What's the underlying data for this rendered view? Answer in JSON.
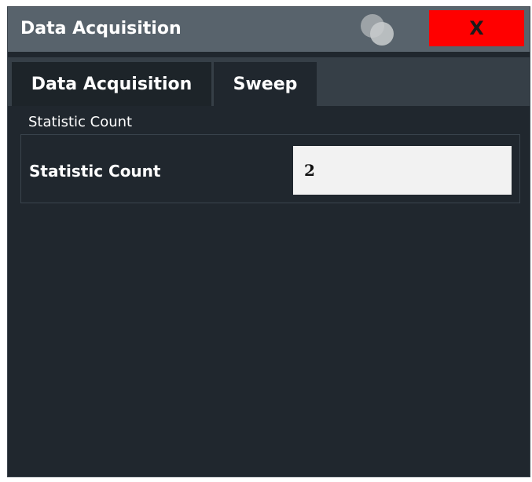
{
  "window": {
    "title": "Data Acquisition",
    "close_label": "X"
  },
  "tabs": [
    {
      "label": "Data Acquisition",
      "active": false
    },
    {
      "label": "Sweep",
      "active": true
    }
  ],
  "group": {
    "title": "Statistic Count",
    "field_label": "Statistic Count",
    "field_value": "2"
  },
  "colors": {
    "titlebar": "#58636c",
    "close": "#ff0000",
    "background": "#20272e",
    "tabstrip": "#363f47"
  }
}
